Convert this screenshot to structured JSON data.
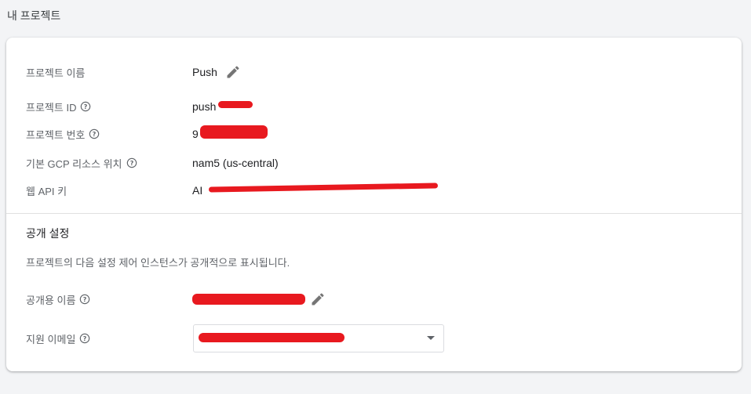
{
  "page": {
    "title": "내 프로젝트"
  },
  "project": {
    "name_label": "프로젝트 이름",
    "name_value": "Push",
    "id_label": "프로젝트 ID",
    "id_value": "push",
    "number_label": "프로젝트 번호",
    "number_value": "9",
    "gcp_location_label": "기본 GCP 리소스 위치",
    "gcp_location_value": "nam5 (us-central)",
    "web_api_key_label": "웹 API 키",
    "web_api_key_value": "AI"
  },
  "public_settings": {
    "title": "공개 설정",
    "description": "프로젝트의 다음 설정 제어 인스턴스가 공개적으로 표시됩니다.",
    "public_name_label": "공개용 이름",
    "support_email_label": "지원 이메일"
  },
  "icons": {
    "edit": "edit-pencil-icon",
    "help": "help-circle-icon",
    "dropdown": "dropdown-arrow-icon"
  },
  "colors": {
    "redaction": "#e8191f",
    "label": "#5f6368",
    "text": "#202124"
  }
}
